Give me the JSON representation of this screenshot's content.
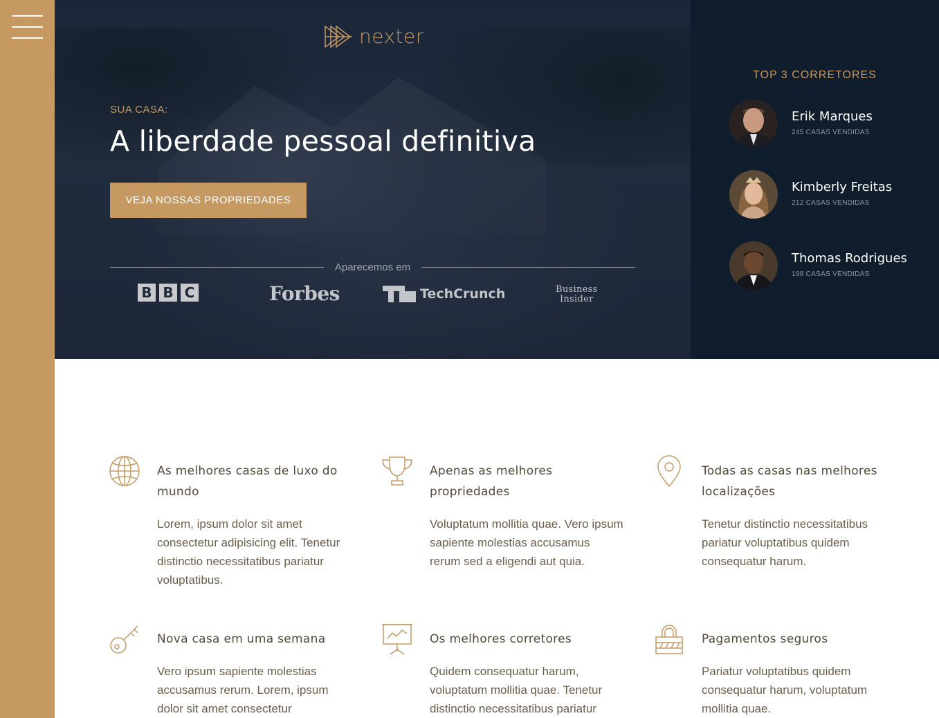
{
  "nav": {
    "menu_icon": "hamburger-menu-icon"
  },
  "brand": {
    "logo_text": "nexter",
    "logo_icon": "triangle-play-logo-icon",
    "accent": "#c69963"
  },
  "hero": {
    "subtitle": "SUA CASA:",
    "title": "A liberdade pessoal definitiva",
    "cta_label": "VEJA NOSSAS PROPRIEDADES",
    "seen_on_label": "Aparecemos em",
    "press": [
      {
        "name": "BBC",
        "letters": [
          "B",
          "B",
          "C"
        ]
      },
      {
        "name": "Forbes"
      },
      {
        "name": "TechCrunch"
      },
      {
        "name": "Business Insider",
        "line1": "Business",
        "line2": "Insider"
      }
    ]
  },
  "realtors": {
    "title": "TOP 3 CORRETORES",
    "items": [
      {
        "name": "Erik Marques",
        "sold": "245 CASAS VENDIDAS"
      },
      {
        "name": "Kimberly Freitas",
        "sold": "212 CASAS VENDIDAS"
      },
      {
        "name": "Thomas Rodrigues",
        "sold": "198 CASAS VENDIDAS"
      }
    ]
  },
  "features": [
    {
      "icon": "globe-icon",
      "title": "As melhores casas de luxo do mundo",
      "text": "Lorem, ipsum dolor sit amet consectetur adipisicing elit. Tenetur distinctio necessitatibus pariatur voluptatibus."
    },
    {
      "icon": "trophy-icon",
      "title": "Apenas as melhores propriedades",
      "text": "Voluptatum mollitia quae. Vero ipsum sapiente molestias accusamus rerum sed a eligendi aut quia."
    },
    {
      "icon": "map-pin-icon",
      "title": "Todas as casas nas melhores localizações",
      "text": "Tenetur distinctio necessitatibus pariatur voluptatibus quidem consequatur harum."
    },
    {
      "icon": "key-icon",
      "title": "Nova casa em uma semana",
      "text": "Vero ipsum sapiente molestias accusamus rerum. Lorem, ipsum dolor sit amet consectetur"
    },
    {
      "icon": "presentation-chart-icon",
      "title": "Os melhores corretores",
      "text": "Quidem consequatur harum, voluptatum mollitia quae. Tenetur distinctio necessitatibus pariatur"
    },
    {
      "icon": "lock-icon",
      "title": "Pagamentos seguros",
      "text": "Pariatur voluptatibus quidem consequatur harum, voluptatum mollitia quae."
    }
  ]
}
